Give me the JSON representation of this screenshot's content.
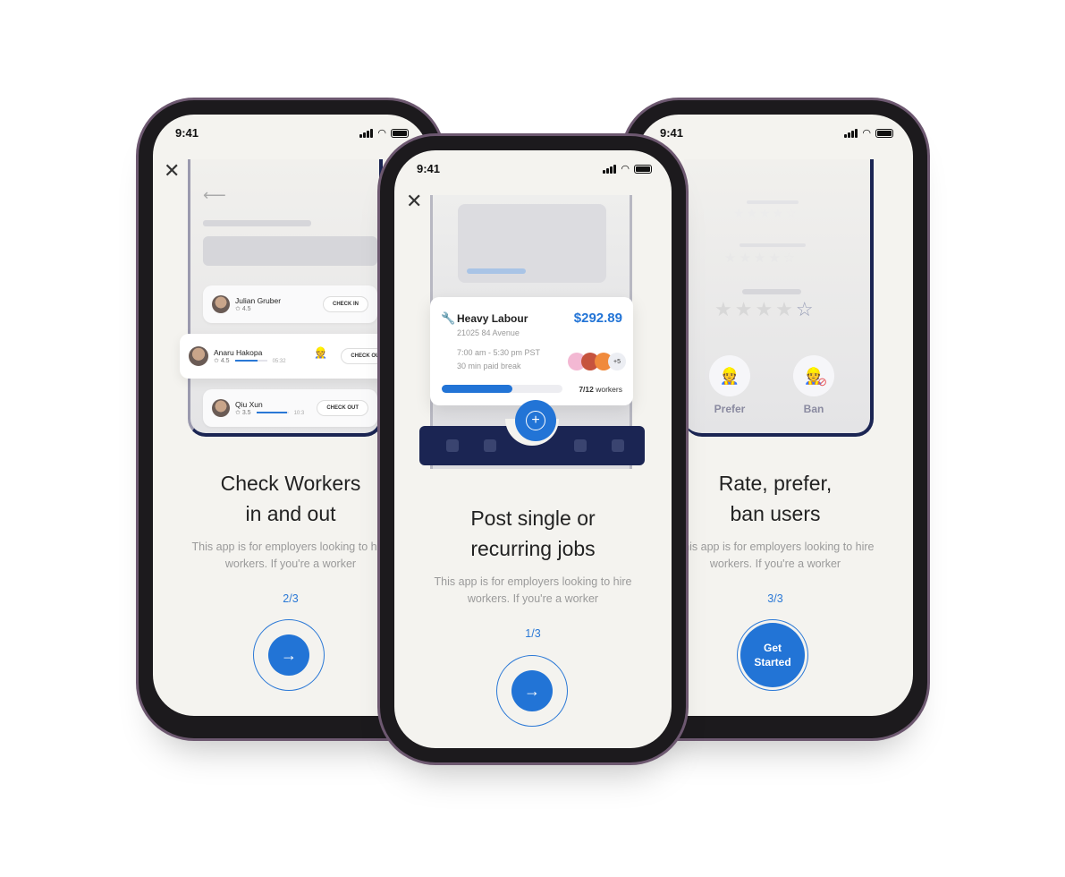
{
  "status": {
    "time": "9:41"
  },
  "colors": {
    "accent": "#2274d6",
    "navy": "#1b2553",
    "ban": "#e8585b"
  },
  "left": {
    "title_line1": "Check Workers",
    "title_line2": "in and out",
    "desc_line1": "This app is for employers looking to hire",
    "desc_line2": "workers. If you're a worker",
    "step": "2/3",
    "next_icon": "arrow-right-icon",
    "arrow": "→",
    "workers": [
      {
        "name": "Julian Gruber",
        "rating": "4.5",
        "action": "CHECK IN"
      },
      {
        "name": "Anaru Hakopa",
        "rating": "4.5",
        "time": "05:32",
        "progress": 0.7,
        "action": "CHECK OUT"
      },
      {
        "name": "Qiu Xun",
        "rating": "3.5",
        "time": "10:3",
        "progress": 0.95,
        "action": "CHECK OUT"
      }
    ]
  },
  "center": {
    "title_line1": "Post single or",
    "title_line2": "recurring jobs",
    "desc_line1": "This app is for employers looking to hire",
    "desc_line2": "workers. If you're a worker",
    "step": "1/3",
    "arrow": "→",
    "job": {
      "title": "Heavy Labour",
      "price": "$292.89",
      "address": "21025 84 Avenue",
      "hours": "7:00 am - 5:30 pm PST",
      "break": "30 min paid break",
      "extra_workers": "+5",
      "filled": "7/12",
      "workers_label": "workers",
      "progress": 0.583
    },
    "plus": "+"
  },
  "right": {
    "title_line1": "Rate, prefer,",
    "title_line2": "ban users",
    "desc_line1": "This app is for employers looking to hire",
    "desc_line2": "workers. If you're a worker",
    "step": "3/3",
    "cta_line1": "Get",
    "cta_line2": "Started",
    "prefer": "Prefer",
    "ban": "Ban",
    "rating": 4
  }
}
